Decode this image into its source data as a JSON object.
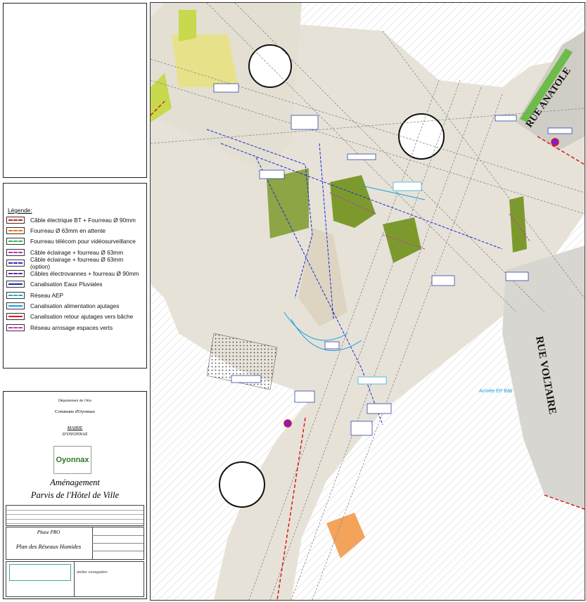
{
  "legend": {
    "title": "Légende:",
    "items": [
      {
        "label": "Câble électrique BT + Fourreau Ø 90mm",
        "color": "#d91a1a",
        "dashed": true
      },
      {
        "label": "Fourreau Ø 63mm en attente",
        "color": "#ff6a00",
        "dashed": true
      },
      {
        "label": "Fourreau télécom pour vidéosurveillance",
        "color": "#39b54a",
        "dashed": true
      },
      {
        "label": "Câble éclairage + fourreau Ø 63mm",
        "color": "#c02cc9",
        "dashed": true
      },
      {
        "label": "Câble éclairage + fourreau Ø 63mm (option)",
        "color": "#2b2bd6",
        "dashed": true
      },
      {
        "label": "Câbles électrovannes + fourreau Ø 90mm",
        "color": "#6a1fb3",
        "dashed": true
      },
      {
        "label": "Canalisation Eaux Pluviales",
        "color": "#1726a8",
        "dashed": false
      },
      {
        "label": "Réseau AEP",
        "color": "#1aa8d6",
        "dashed": true
      },
      {
        "label": "Canalisation alimentation ajutages",
        "color": "#16a0e0",
        "dashed": false
      },
      {
        "label": "Canalisation retour ajutages vers bâche",
        "color": "#e01a1a",
        "dashed": false
      },
      {
        "label": "Réseau arrosage espaces verts",
        "color": "#d42bd4",
        "dashed": true
      }
    ]
  },
  "cartouche": {
    "departement": "Département de l'Ain",
    "commune": "Commune d'Oyonnax",
    "mairie": "MAIRIE",
    "ville": "D'OYONNAX",
    "logo": "Oyonnax",
    "projet1": "Aménagement",
    "projet2": "Parvis de l'Hôtel de Ville",
    "phase": "Phase PRO",
    "plan": "Plan des Réseaux Humides",
    "agence": "atelier oxoagaden"
  },
  "plan": {
    "streets": [
      "RUE ANATOLE",
      "RUE VOLTAIRE"
    ],
    "note": "Arrivée EP Bâti"
  }
}
